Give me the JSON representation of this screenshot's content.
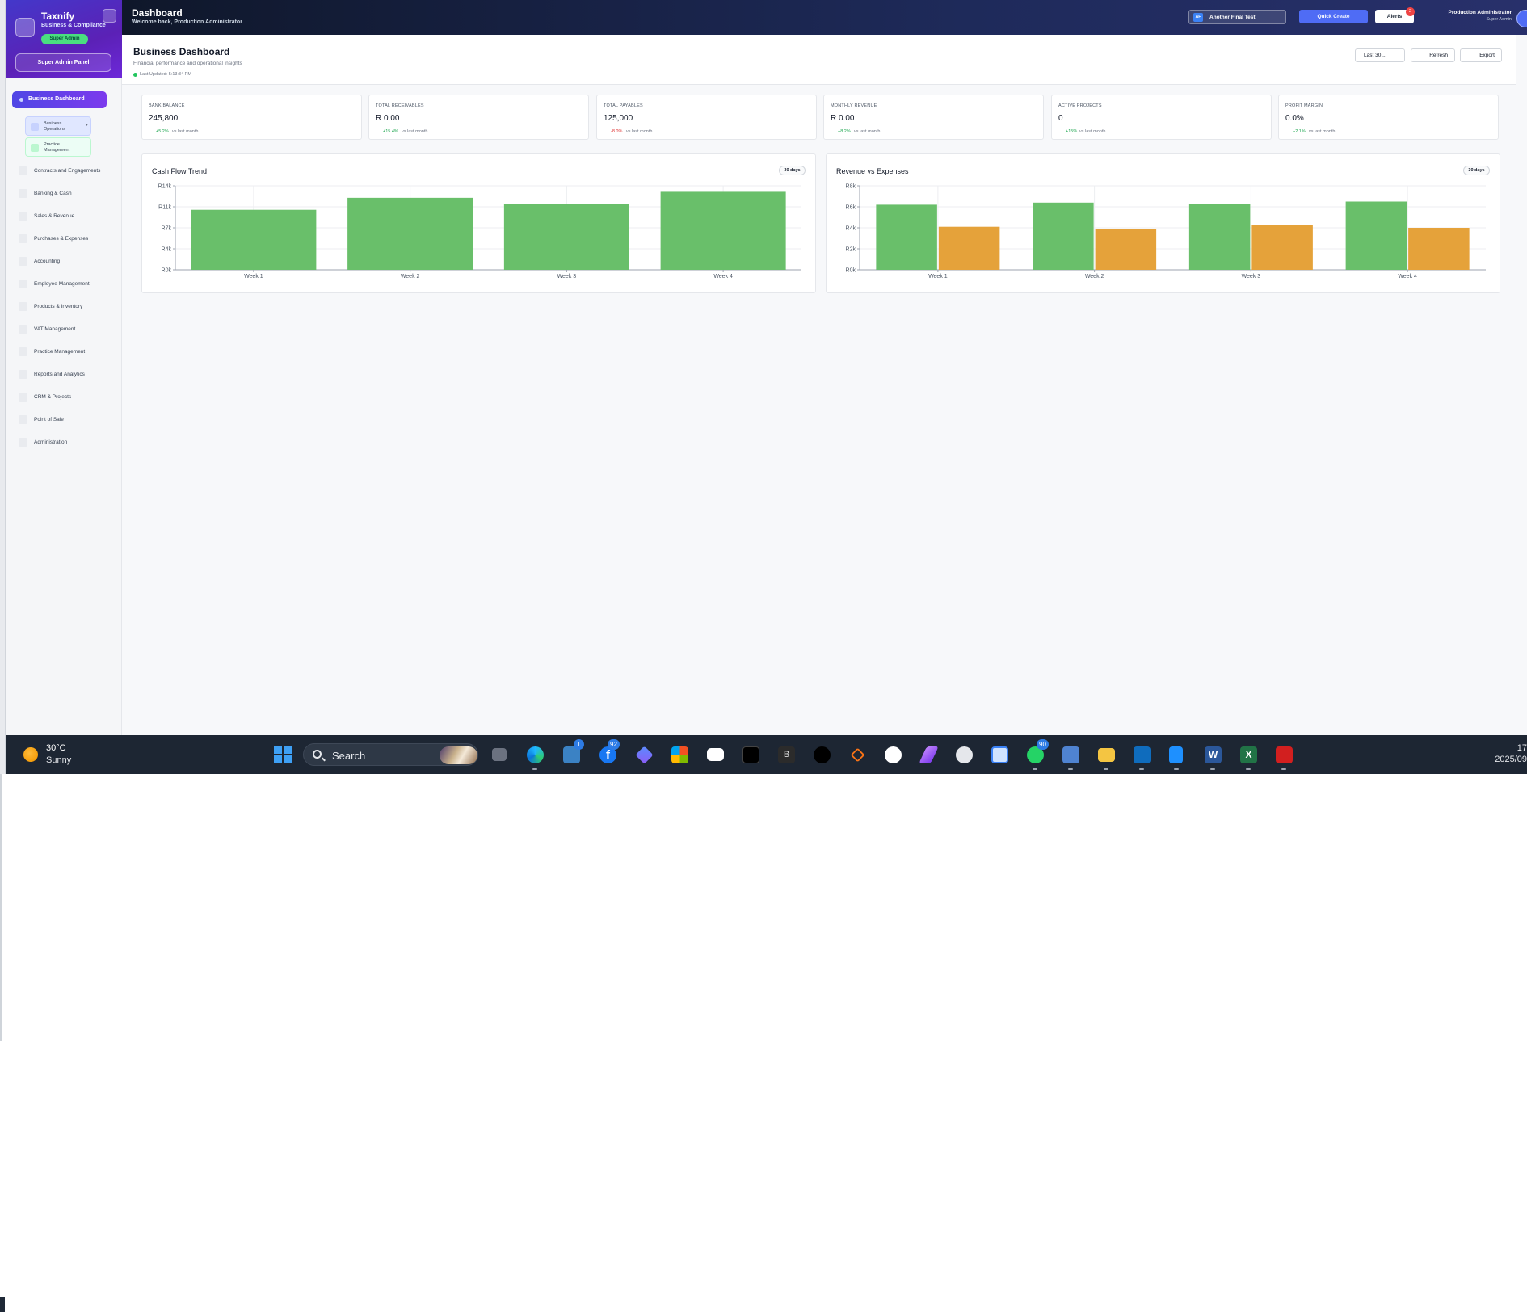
{
  "sidebar": {
    "brand": "Taxnify",
    "tagline": "Business & Compliance",
    "role_badge": "Super Admin",
    "admin_panel": "Super Admin Panel",
    "active_item": "Business Dashboard",
    "sub_items": [
      "Business Operations",
      "Practice Management"
    ],
    "items": [
      "Contracts and Engagements",
      "Banking & Cash",
      "Sales & Revenue",
      "Purchases & Expenses",
      "Accounting",
      "Employee Management",
      "Products & Inventory",
      "VAT Management",
      "Practice Management",
      "Reports and Analytics",
      "CRM & Projects",
      "Point of Sale",
      "Administration"
    ]
  },
  "header": {
    "title": "Dashboard",
    "welcome": "Welcome back, Production Administrator",
    "company_icon": "AF",
    "company": "Another Final Test",
    "quick_create": "Quick Create",
    "alerts": "Alerts",
    "alerts_count": "2",
    "user_name": "Production Administrator",
    "user_role": "Super Admin"
  },
  "page": {
    "title": "Business Dashboard",
    "subtitle": "Financial performance and operational insights",
    "last_updated": "Last Updated: 5:13:34 PM",
    "range_button": "Last 30...",
    "refresh_button": "Refresh",
    "export_button": "Export"
  },
  "kpis": [
    {
      "label": "BANK BALANCE",
      "value": "245,800",
      "change": "+5.2%",
      "suffix": "vs last month",
      "positive": true
    },
    {
      "label": "TOTAL RECEIVABLES",
      "value": "R 0.00",
      "change": "+15.4%",
      "suffix": "vs last month",
      "positive": true
    },
    {
      "label": "TOTAL PAYABLES",
      "value": "125,000",
      "change": "-8.0%",
      "suffix": "vs last month",
      "positive": false
    },
    {
      "label": "MONTHLY REVENUE",
      "value": "R 0.00",
      "change": "+8.2%",
      "suffix": "vs last month",
      "positive": true
    },
    {
      "label": "ACTIVE PROJECTS",
      "value": "0",
      "change": "+15%",
      "suffix": "vs last month",
      "positive": true
    },
    {
      "label": "PROFIT MARGIN",
      "value": "0.0%",
      "change": "+2.1%",
      "suffix": "vs last month",
      "positive": true
    }
  ],
  "chart_data": [
    {
      "type": "bar",
      "title": "Cash Flow Trend",
      "period": "30 days",
      "categories": [
        "Week 1",
        "Week 2",
        "Week 3",
        "Week 4"
      ],
      "values": [
        10000,
        12000,
        11000,
        13000
      ],
      "yticks": [
        "R0k",
        "R4k",
        "R7k",
        "R11k",
        "R14k"
      ],
      "ylim": [
        0,
        14000
      ],
      "color": "#69bf6a",
      "grid": true
    },
    {
      "type": "bar",
      "title": "Revenue vs Expenses",
      "period": "30 days",
      "categories": [
        "Week 1",
        "Week 2",
        "Week 3",
        "Week 4"
      ],
      "series": [
        {
          "values": [
            6200,
            6400,
            6300,
            6500
          ],
          "color": "#69bf6a"
        },
        {
          "values": [
            4100,
            3900,
            4300,
            4000
          ],
          "color": "#e5a23a"
        }
      ],
      "yticks": [
        "R0k",
        "R2k",
        "R4k",
        "R6k",
        "R8k"
      ],
      "ylim": [
        0,
        8000
      ],
      "grid": true
    }
  ],
  "taskbar": {
    "temperature": "30°C",
    "condition": "Sunny",
    "search": "Search",
    "time": "17",
    "date": "2025/09",
    "badges": {
      "store": "1",
      "facebook": "92",
      "whatsapp": "90"
    }
  },
  "colors": {
    "accent": "#4f46e5",
    "positive": "#16a34a",
    "negative": "#dc2626"
  }
}
